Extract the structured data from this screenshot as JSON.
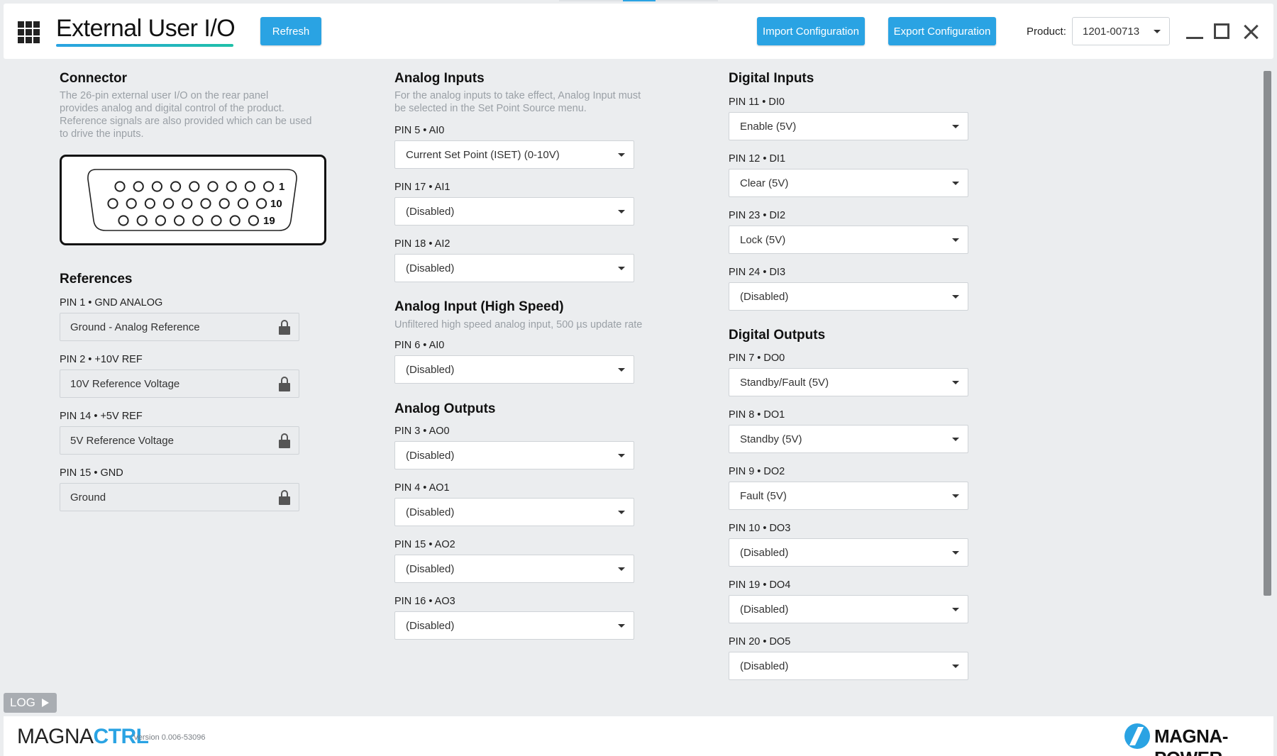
{
  "header": {
    "title": "External User I/O",
    "refresh_label": "Refresh",
    "import_label": "Import Configuration",
    "export_label": "Export Configuration",
    "product_label": "Product:",
    "product_value": "1201-00713"
  },
  "connector": {
    "title": "Connector",
    "description_lines": [
      "The 26-pin external user I/O on the rear panel",
      "provides analog and digital control of the product.",
      "Reference signals are also provided which can be used",
      "to drive the inputs."
    ],
    "row_labels": [
      "1",
      "10",
      "19"
    ]
  },
  "references": {
    "title": "References",
    "items": [
      {
        "label": "PIN 1 • GND ANALOG",
        "value": "Ground - Analog Reference"
      },
      {
        "label": "PIN 2 • +10V REF",
        "value": "10V Reference Voltage"
      },
      {
        "label": "PIN 14 • +5V REF",
        "value": "5V Reference Voltage"
      },
      {
        "label": "PIN 15 • GND",
        "value": "Ground"
      }
    ]
  },
  "analog_inputs": {
    "title": "Analog Inputs",
    "description_lines": [
      "For the analog inputs to take effect, Analog Input must",
      "be selected in the Set Point Source menu."
    ],
    "items": [
      {
        "label": "PIN 5 • AI0",
        "value": "Current Set Point (ISET) (0-10V)"
      },
      {
        "label": "PIN 17 • AI1",
        "value": "(Disabled)"
      },
      {
        "label": "PIN 18 • AI2",
        "value": "(Disabled)"
      }
    ]
  },
  "analog_input_hs": {
    "title": "Analog Input (High Speed)",
    "description": "Unfiltered high speed analog input, 500 µs update rate",
    "items": [
      {
        "label": "PIN 6 • AI0",
        "value": "(Disabled)"
      }
    ]
  },
  "analog_outputs": {
    "title": "Analog Outputs",
    "items": [
      {
        "label": "PIN 3 • AO0",
        "value": "(Disabled)"
      },
      {
        "label": "PIN 4 • AO1",
        "value": "(Disabled)"
      },
      {
        "label": "PIN 15 • AO2",
        "value": "(Disabled)"
      },
      {
        "label": "PIN 16 • AO3",
        "value": "(Disabled)"
      }
    ]
  },
  "digital_inputs": {
    "title": "Digital Inputs",
    "items": [
      {
        "label": "PIN 11 • DI0",
        "value": "Enable (5V)"
      },
      {
        "label": "PIN 12 • DI1",
        "value": "Clear (5V)"
      },
      {
        "label": "PIN 23 • DI2",
        "value": "Lock (5V)"
      },
      {
        "label": "PIN 24 • DI3",
        "value": "(Disabled)"
      }
    ]
  },
  "digital_outputs": {
    "title": "Digital Outputs",
    "items": [
      {
        "label": "PIN 7 • DO0",
        "value": "Standby/Fault (5V)"
      },
      {
        "label": "PIN 8 • DO1",
        "value": "Standby (5V)"
      },
      {
        "label": "PIN 9 • DO2",
        "value": "Fault (5V)"
      },
      {
        "label": "PIN 10 • DO3",
        "value": "(Disabled)"
      },
      {
        "label": "PIN 19 • DO4",
        "value": "(Disabled)"
      },
      {
        "label": "PIN 20 • DO5",
        "value": "(Disabled)"
      }
    ]
  },
  "log": {
    "label": "LOG"
  },
  "footer": {
    "brand_part1": "MAGNA",
    "brand_part2": "CTRL",
    "version": "Version 0.006-53096",
    "company": "MAGNA-POWER"
  },
  "colors": {
    "accent": "#2aa3e3",
    "accent_secondary": "#1fc0a8",
    "background": "#ebedef"
  }
}
